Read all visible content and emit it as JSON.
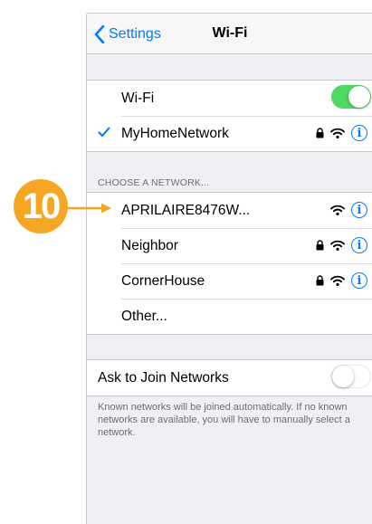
{
  "navbar": {
    "back_label": "Settings",
    "title": "Wi-Fi"
  },
  "wifi_toggle": {
    "label": "Wi-Fi",
    "on": true
  },
  "connected": {
    "network": "MyHomeNetwork",
    "secured": true
  },
  "choose_section": {
    "header": "CHOOSE A NETWORK...",
    "networks": [
      {
        "name": "APRILAIRE8476W...",
        "secured": false
      },
      {
        "name": "Neighbor",
        "secured": true
      },
      {
        "name": "CornerHouse",
        "secured": true
      }
    ],
    "other_label": "Other..."
  },
  "ask_to_join": {
    "label": "Ask to Join Networks",
    "on": false
  },
  "footer_text": "Known networks will be joined automatically. If no known networks are available, you will have to manually select a network.",
  "annotation": {
    "step_number": "10",
    "color": "#f5a623"
  },
  "colors": {
    "accent": "#007aff",
    "toggle_on": "#4cd964",
    "badge": "#f5a623"
  },
  "icons": [
    "chevron-left-icon",
    "checkmark-icon",
    "lock-icon",
    "wifi-icon",
    "info-icon"
  ]
}
